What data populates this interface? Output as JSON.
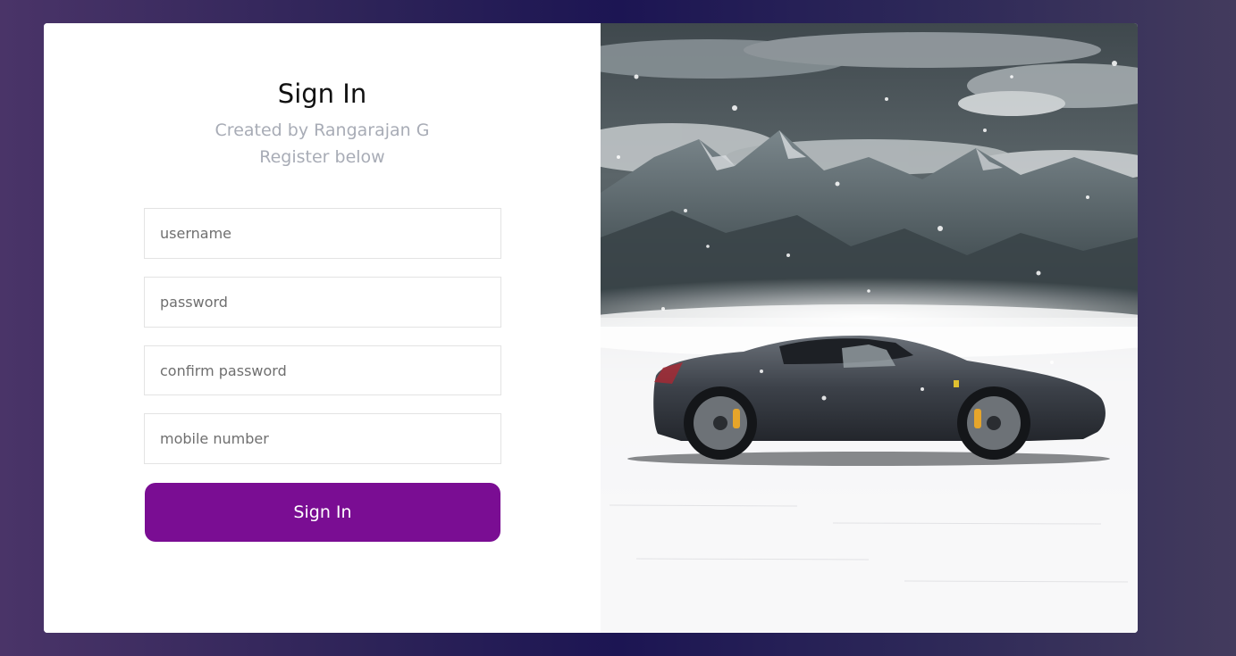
{
  "form": {
    "title": "Sign In",
    "subtitle_line1": "Created by Rangarajan G",
    "subtitle_line2": "Register below",
    "fields": [
      {
        "placeholder": "username",
        "value": ""
      },
      {
        "placeholder": "password",
        "value": ""
      },
      {
        "placeholder": "confirm password",
        "value": ""
      },
      {
        "placeholder": "mobile number",
        "value": ""
      }
    ],
    "submit_label": "Sign In"
  },
  "hero_image": {
    "subject": "sports-car-in-snowy-mountains"
  },
  "colors": {
    "accent": "#7a0d93",
    "subtitle": "#a8acb6",
    "background_gradient_mid": "#1c1553"
  }
}
